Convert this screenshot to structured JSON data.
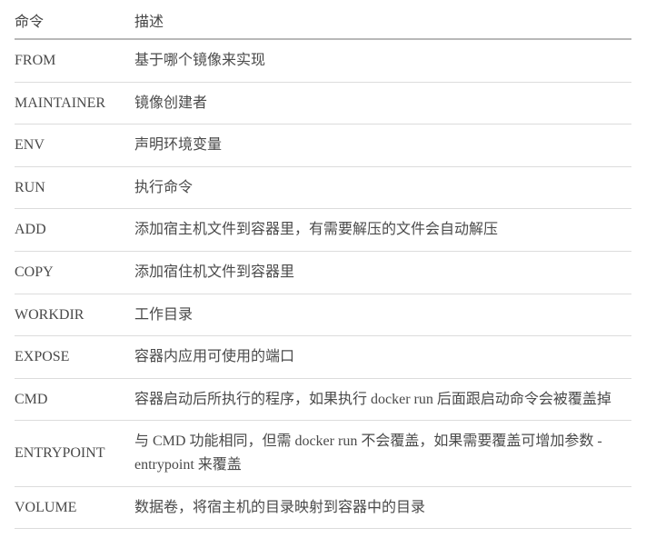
{
  "table": {
    "headers": {
      "command": "命令",
      "description": "描述"
    },
    "rows": [
      {
        "command": "FROM",
        "description": "基于哪个镜像来实现"
      },
      {
        "command": "MAINTAINER",
        "description": "镜像创建者"
      },
      {
        "command": "ENV",
        "description": "声明环境变量"
      },
      {
        "command": "RUN",
        "description": "执行命令"
      },
      {
        "command": "ADD",
        "description": "添加宿主机文件到容器里，有需要解压的文件会自动解压"
      },
      {
        "command": "COPY",
        "description": "添加宿住机文件到容器里"
      },
      {
        "command": "WORKDIR",
        "description": "工作目录"
      },
      {
        "command": "EXPOSE",
        "description": "容器内应用可使用的端口"
      },
      {
        "command": "CMD",
        "description": "容器启动后所执行的程序，如果执行 docker run 后面跟启动命令会被覆盖掉"
      },
      {
        "command": "ENTRYPOINT",
        "description": "与 CMD 功能相同，但需 docker run 不会覆盖，如果需要覆盖可增加参数 -entrypoint 来覆盖"
      },
      {
        "command": "VOLUME",
        "description": "数据卷，将宿主机的目录映射到容器中的目录"
      }
    ]
  }
}
